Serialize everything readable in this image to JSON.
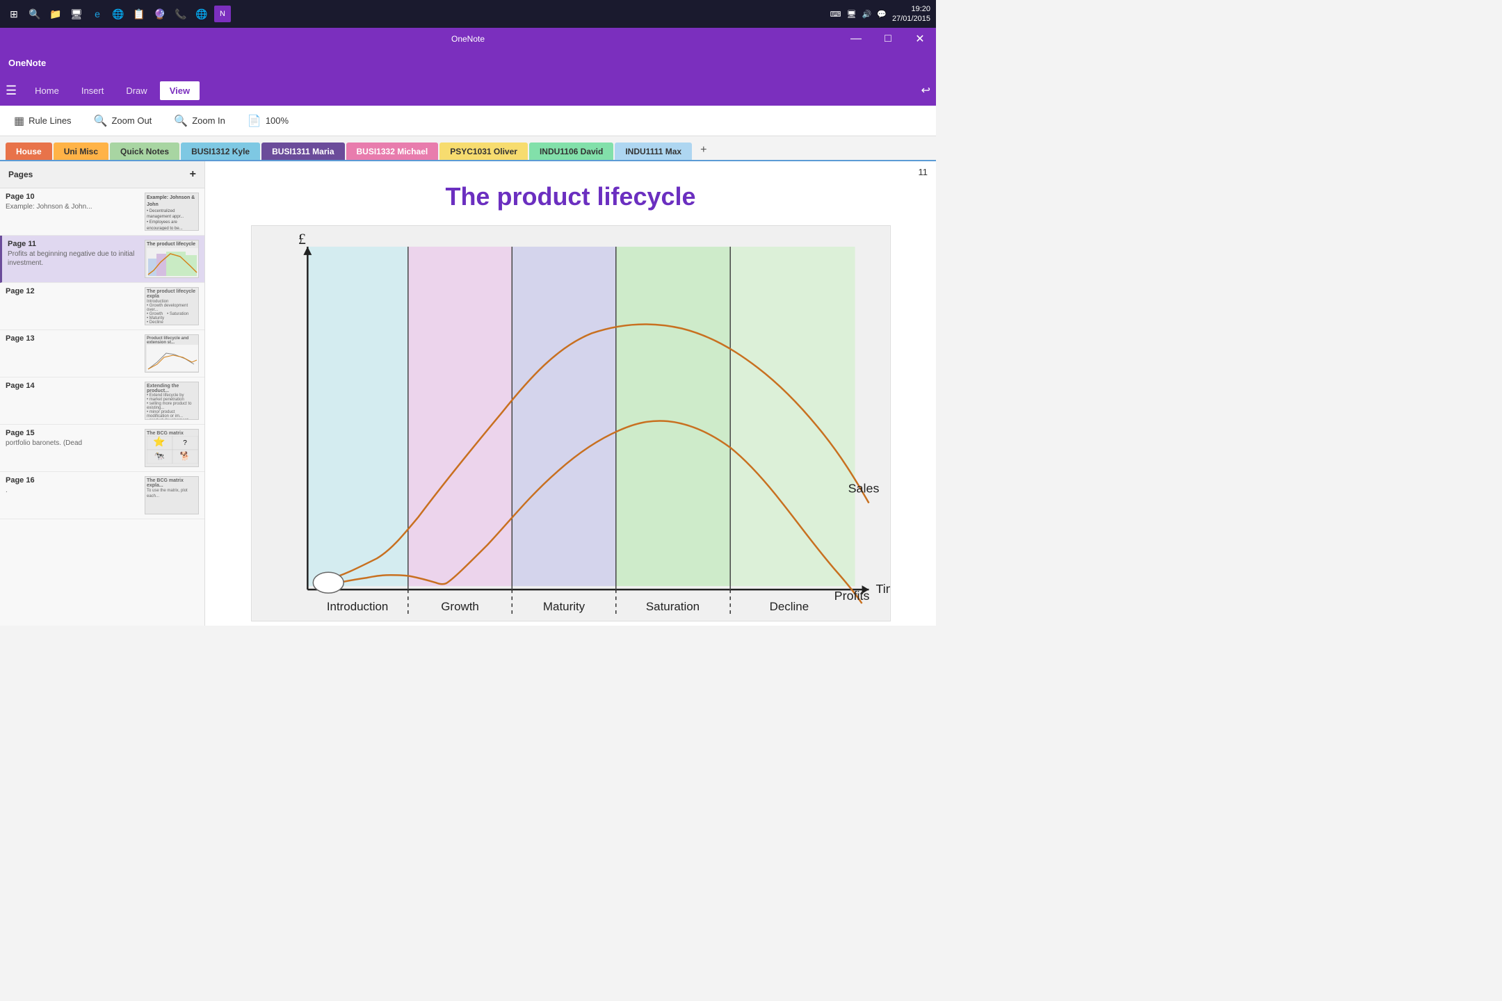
{
  "taskbar": {
    "time": "19:20",
    "date": "27/01/2015",
    "app_title": "OneNote"
  },
  "title_bar": {
    "label": "OneNote",
    "minimize": "—",
    "maximize": "□",
    "close": "✕"
  },
  "ribbon": {
    "hamburger": "☰",
    "tabs": [
      {
        "label": "Home",
        "active": false
      },
      {
        "label": "Insert",
        "active": false
      },
      {
        "label": "Draw",
        "active": false
      },
      {
        "label": "View",
        "active": true
      }
    ]
  },
  "toolbar": {
    "rule_lines": "Rule Lines",
    "zoom_out": "Zoom Out",
    "zoom_in": "Zoom In",
    "zoom_level": "100%"
  },
  "notebook_tabs": [
    {
      "label": "House",
      "class": "house"
    },
    {
      "label": "Uni Misc",
      "class": "uni-misc"
    },
    {
      "label": "Quick Notes",
      "class": "quick-notes"
    },
    {
      "label": "BUSI1312 Kyle",
      "class": "busi1312"
    },
    {
      "label": "BUSI1311 Maria",
      "class": "busi1311-maria"
    },
    {
      "label": "BUSI1332 Michael",
      "class": "busi1332"
    },
    {
      "label": "PSYC1031 Oliver",
      "class": "psyc1031"
    },
    {
      "label": "INDU1106 David",
      "class": "indu1106"
    },
    {
      "label": "INDU1111 Max",
      "class": "indu1111"
    }
  ],
  "sidebar": {
    "pages_label": "Pages",
    "add_icon": "+",
    "pages": [
      {
        "title": "Page 10",
        "sub": "Example: Johnson & John...",
        "active": false
      },
      {
        "title": "Page 11",
        "sub": "Profits at beginning negative due to initial investment.",
        "active": true
      },
      {
        "title": "Page 12",
        "sub": "The product lifecycle expla...",
        "active": false
      },
      {
        "title": "Page 13",
        "sub": "Product lifecycle and extension st...",
        "active": false
      },
      {
        "title": "Page 14",
        "sub": "Extending the product...",
        "active": false
      },
      {
        "title": "Page 15",
        "sub": "portfolio baronets. (Dead",
        "active": false
      },
      {
        "title": "Page 16",
        "sub": "The BCG matrix expla...",
        "active": false
      }
    ]
  },
  "content": {
    "page_number": "11",
    "title": "The product lifecycle",
    "chart": {
      "x_label": "Time",
      "y_label": "£",
      "phases": [
        "Introduction",
        "Growth",
        "Maturity",
        "Saturation",
        "Decline"
      ],
      "curves": [
        "Sales",
        "Profits"
      ]
    }
  }
}
